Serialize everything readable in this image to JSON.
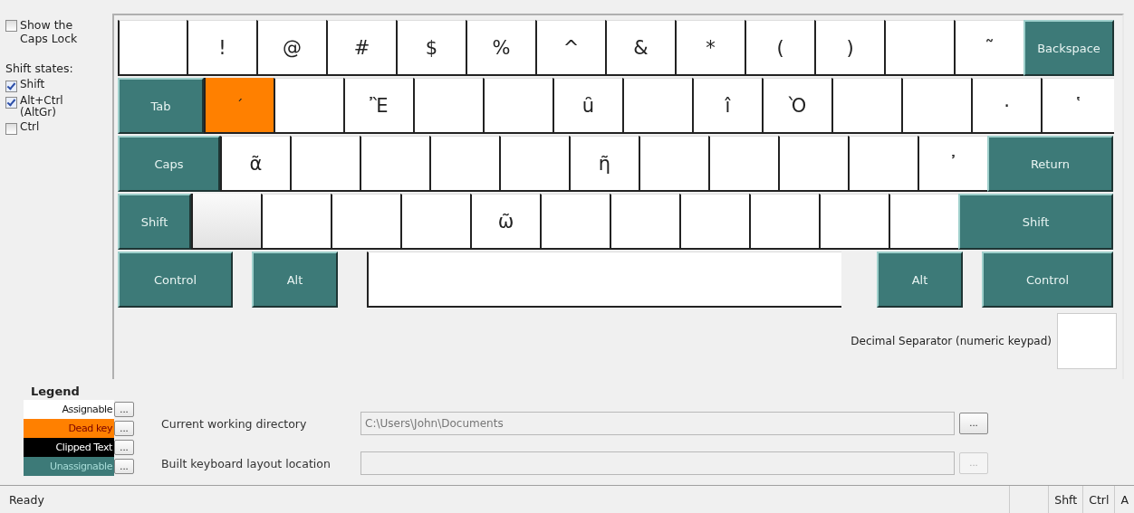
{
  "options": {
    "caps_lock": {
      "label": "Show the Caps Lock",
      "checked": false
    },
    "shift_states_label": "Shift states:",
    "shift_states": [
      {
        "label": "Shift",
        "checked": true
      },
      {
        "label": "Alt+Ctrl (AltGr)",
        "checked": true
      },
      {
        "label": "Ctrl",
        "checked": false
      }
    ]
  },
  "keyboard": {
    "rows": [
      {
        "keys": [
          {
            "kind": "assignable"
          },
          {
            "label": "!",
            "kind": "assignable"
          },
          {
            "label": "@",
            "kind": "assignable"
          },
          {
            "label": "#",
            "kind": "assignable"
          },
          {
            "label": "$",
            "kind": "assignable"
          },
          {
            "label": "%",
            "kind": "assignable"
          },
          {
            "label": "^",
            "kind": "assignable"
          },
          {
            "label": "&",
            "kind": "assignable"
          },
          {
            "label": "*",
            "kind": "assignable"
          },
          {
            "label": "(",
            "kind": "assignable"
          },
          {
            "label": ")",
            "kind": "assignable"
          },
          {
            "kind": "assignable"
          },
          {
            "label": "῀",
            "kind": "assignable"
          },
          {
            "label": "Backspace",
            "kind": "unassignable"
          }
        ]
      },
      {
        "keys": [
          {
            "label": "Tab",
            "kind": "unassignable"
          },
          {
            "label": "´",
            "kind": "dead"
          },
          {
            "kind": "assignable"
          },
          {
            "label": "Ἒ",
            "kind": "assignable"
          },
          {
            "kind": "assignable"
          },
          {
            "kind": "assignable"
          },
          {
            "label": "ȗ",
            "kind": "assignable"
          },
          {
            "kind": "assignable"
          },
          {
            "label": "î",
            "kind": "assignable"
          },
          {
            "label": "Ὸ",
            "kind": "assignable"
          },
          {
            "kind": "assignable"
          },
          {
            "kind": "assignable"
          },
          {
            "label": "·",
            "kind": "assignable"
          },
          {
            "label": "῾",
            "kind": "assignable"
          }
        ]
      },
      {
        "keys": [
          {
            "label": "Caps",
            "kind": "unassignable"
          },
          {
            "label": "ᾶ",
            "kind": "assignable"
          },
          {
            "kind": "assignable"
          },
          {
            "kind": "assignable"
          },
          {
            "kind": "assignable"
          },
          {
            "kind": "assignable"
          },
          {
            "label": "ῆ",
            "kind": "assignable"
          },
          {
            "kind": "assignable"
          },
          {
            "kind": "assignable"
          },
          {
            "kind": "assignable"
          },
          {
            "kind": "assignable"
          },
          {
            "label": "᾽",
            "kind": "assignable"
          },
          {
            "label": "Return",
            "kind": "unassignable"
          }
        ]
      },
      {
        "keys": [
          {
            "label": "Shift",
            "kind": "unassignable"
          },
          {
            "kind": "inactive"
          },
          {
            "kind": "assignable"
          },
          {
            "kind": "assignable"
          },
          {
            "kind": "assignable"
          },
          {
            "label": "ῶ",
            "kind": "assignable"
          },
          {
            "kind": "assignable"
          },
          {
            "kind": "assignable"
          },
          {
            "kind": "assignable"
          },
          {
            "kind": "assignable"
          },
          {
            "kind": "assignable"
          },
          {
            "kind": "assignable"
          },
          {
            "label": "Shift",
            "kind": "unassignable"
          }
        ]
      },
      {
        "keys": [
          {
            "label": "Control",
            "kind": "unassignable"
          },
          {
            "label": "Alt",
            "kind": "unassignable"
          },
          {
            "kind": "assignable"
          },
          {
            "label": "Alt",
            "kind": "unassignable"
          },
          {
            "label": "Control",
            "kind": "unassignable"
          }
        ]
      }
    ],
    "decimal_separator": {
      "label": "Decimal Separator (numeric keypad)",
      "key": {
        "kind": "assignable"
      }
    }
  },
  "legend": {
    "title": "Legend",
    "items": [
      {
        "label": "Assignable",
        "kind": "assignable",
        "color": "#ffffff",
        "button": "..."
      },
      {
        "label": "Dead key",
        "kind": "dead",
        "color": "#ff8000",
        "button": "..."
      },
      {
        "label": "Clipped Text",
        "kind": "clipped",
        "color": "#000000",
        "button": "..."
      },
      {
        "label": "Unassignable",
        "kind": "unassignable",
        "color": "#3d7a78",
        "button": "..."
      }
    ]
  },
  "fields": [
    {
      "label": "Current working directory",
      "value": "C:\\Users\\John\\Documents",
      "button": "...",
      "disabled": false
    },
    {
      "label": "Built keyboard layout location",
      "button": "...",
      "disabled": true
    }
  ],
  "status_bar": {
    "message": "Ready",
    "indicators": [
      "Shft",
      "Ctrl",
      "A"
    ]
  }
}
